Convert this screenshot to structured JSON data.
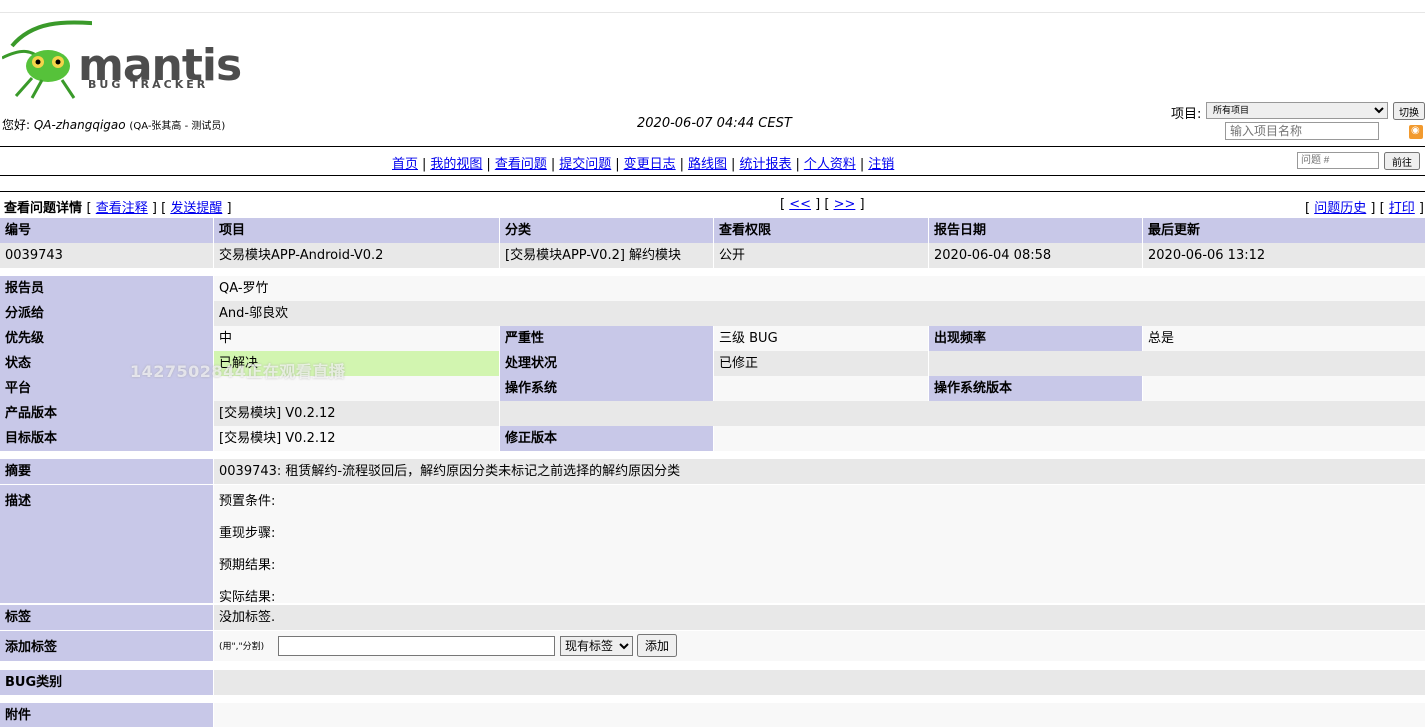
{
  "logo": {
    "word": "mantis",
    "sub": "BUG TRACKER"
  },
  "header": {
    "greeting_prefix": "您好: ",
    "username": "QA-zhangqigao",
    "role": "(QA-张其高 - 测试员)",
    "datetime": "2020-06-07 04:44 CEST",
    "project_label": "项目:",
    "project_selected": "所有项目",
    "switch_label": "切换",
    "project_search_placeholder": "输入项目名称"
  },
  "menu": {
    "items": [
      "首页",
      "我的视图",
      "查看问题",
      "提交问题",
      "变更日志",
      "路线图",
      "统计报表",
      "个人资料",
      "注销"
    ],
    "issue_jump_placeholder": "问题 #",
    "goto_label": "前往"
  },
  "detail": {
    "title": "查看问题详情",
    "view_notes": "查看注释",
    "send_reminder": "发送提醒",
    "prev": "<<",
    "next": ">>",
    "history": "问题历史",
    "print": "打印"
  },
  "summary_headers": [
    "编号",
    "项目",
    "分类",
    "查看权限",
    "报告日期",
    "最后更新"
  ],
  "summary_values": [
    "0039743",
    "交易模块APP-Android-V0.2",
    "[交易模块APP-V0.2] 解约模块",
    "公开",
    "2020-06-04 08:58",
    "2020-06-06 13:12"
  ],
  "fields": {
    "reporter_label": "报告员",
    "reporter": "QA-罗竹",
    "assigned_label": "分派给",
    "assigned": "And-邬良欢",
    "priority_label": "优先级",
    "priority": "中",
    "severity_label": "严重性",
    "severity": "三级 BUG",
    "reproducibility_label": "出现频率",
    "reproducibility": "总是",
    "status_label": "状态",
    "status": "已解决",
    "resolution_label": "处理状况",
    "resolution": "已修正",
    "platform_label": "平台",
    "os_label": "操作系统",
    "os_version_label": "操作系统版本",
    "product_version_label": "产品版本",
    "product_version": "[交易模块] V0.2.12",
    "target_version_label": "目标版本",
    "target_version": "[交易模块] V0.2.12",
    "fixed_version_label": "修正版本",
    "summary_label": "摘要",
    "summary": "0039743: 租赁解约-流程驳回后，解约原因分类未标记之前选择的解约原因分类",
    "description_label": "描述",
    "description_lines": [
      "预置条件:",
      "重现步骤:",
      "预期结果:",
      "实际结果:"
    ],
    "tags_label": "标签",
    "tags": "没加标签.",
    "add_tag_label": "添加标签",
    "add_tag_hint": "(用\",\"分割)",
    "existing_tags": "现有标签",
    "add_button": "添加",
    "bug_category_label": "BUG类别",
    "attachments_label": "附件"
  },
  "watermark": "1427502844正在观看直播"
}
